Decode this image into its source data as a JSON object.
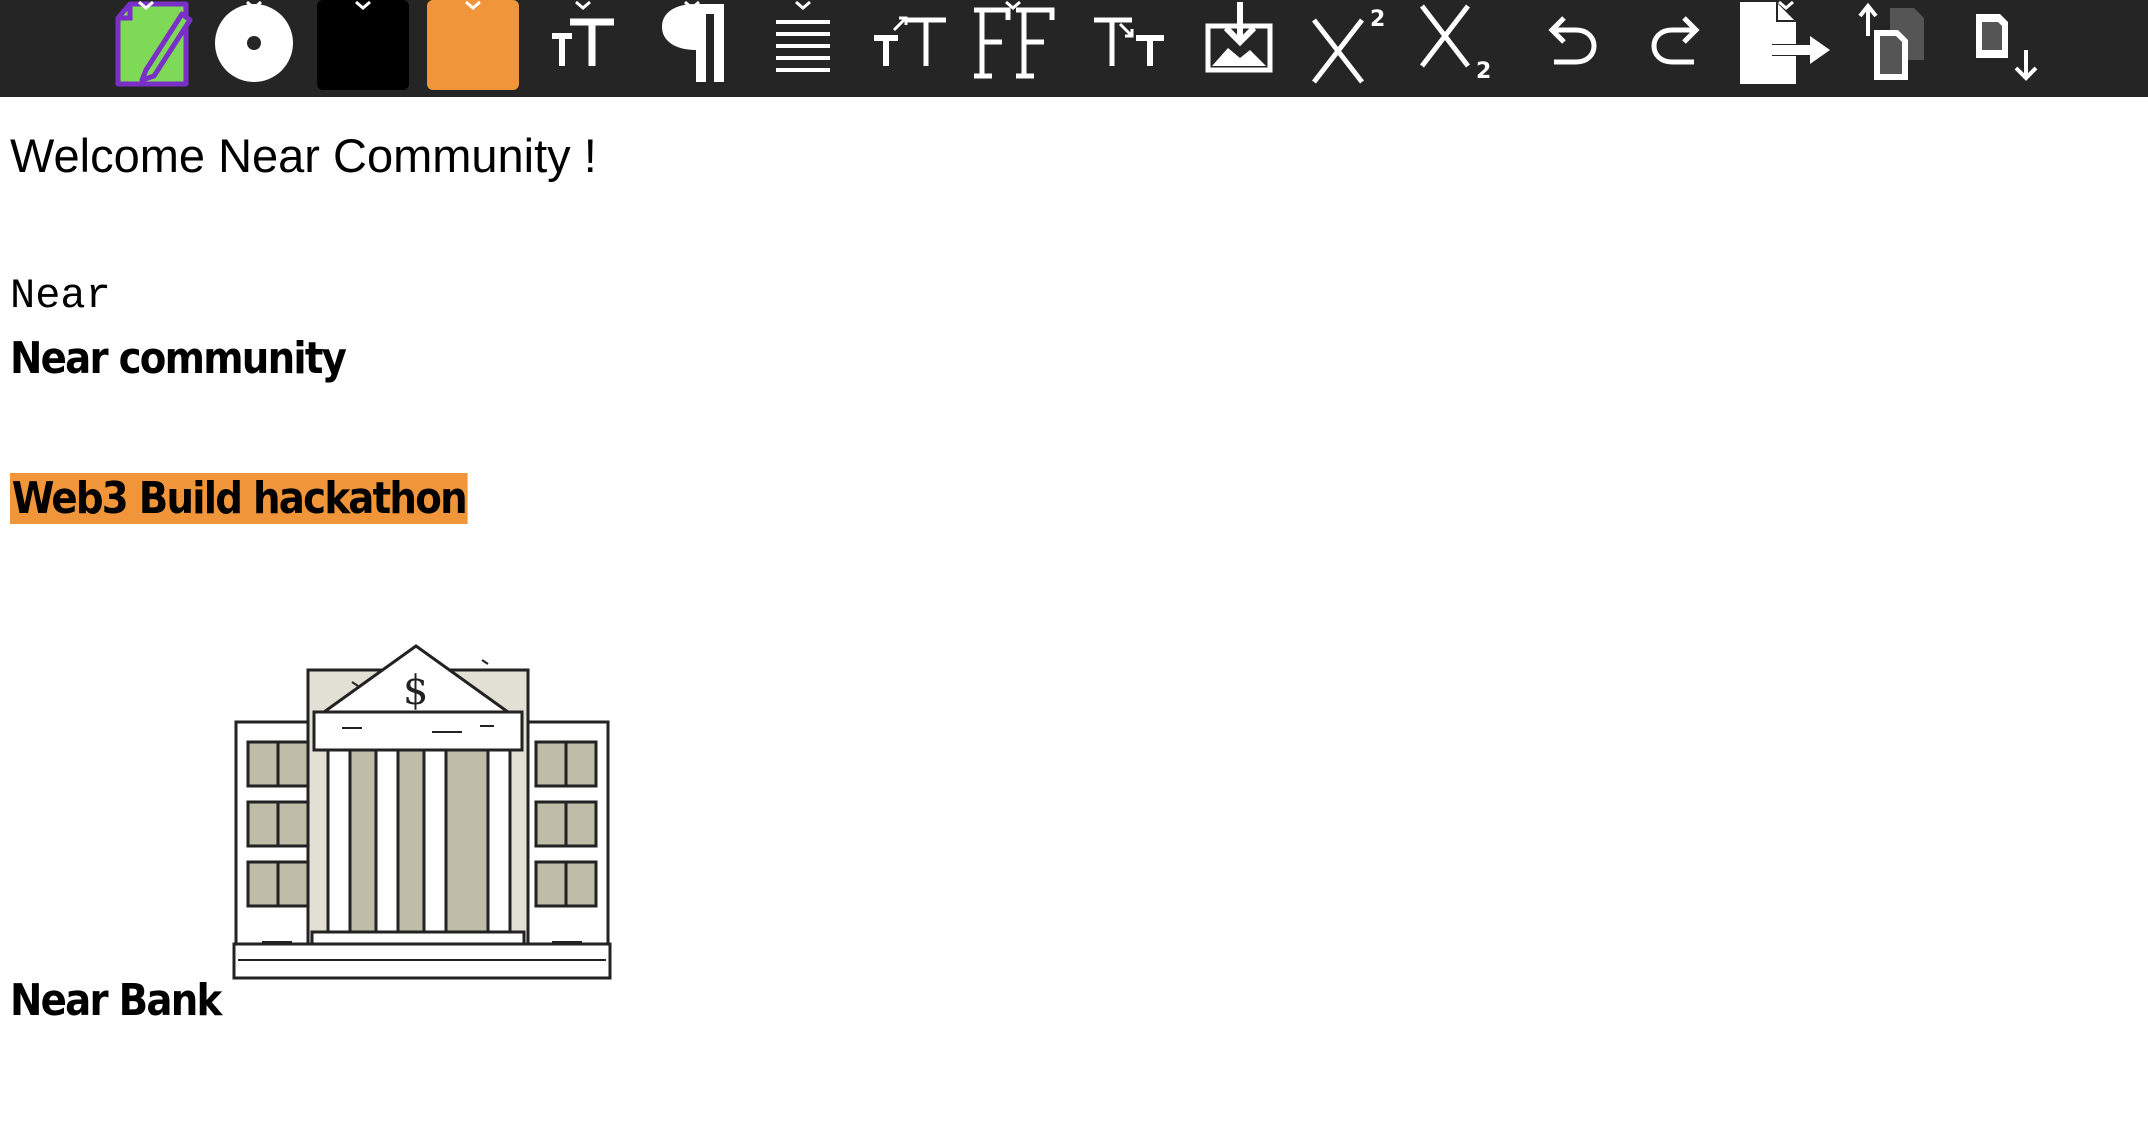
{
  "toolbar": {
    "buttons": [
      {
        "name": "edit-document-icon"
      },
      {
        "name": "disc-icon"
      },
      {
        "name": "text-color-swatch",
        "color": "#000000"
      },
      {
        "name": "highlight-color-swatch",
        "color": "#f0953a"
      },
      {
        "name": "text-size-icon"
      },
      {
        "name": "paragraph-icon"
      },
      {
        "name": "align-icon"
      },
      {
        "name": "increase-font-icon"
      },
      {
        "name": "font-family-icon"
      },
      {
        "name": "decrease-font-icon"
      },
      {
        "name": "insert-image-icon"
      },
      {
        "name": "superscript-icon"
      },
      {
        "name": "subscript-icon"
      },
      {
        "name": "undo-icon"
      },
      {
        "name": "redo-icon"
      },
      {
        "name": "export-icon"
      },
      {
        "name": "copy-upload-icon"
      },
      {
        "name": "download-icon"
      }
    ],
    "colors": {
      "background": "#252525",
      "icon": "#ffffff",
      "accent_green": "#7ed957",
      "accent_purple": "#7b2fc9"
    }
  },
  "document": {
    "welcome": "Welcome Near Community !",
    "mono_line": "Near",
    "bold_line": "Near community",
    "highlight_line": "Web3 Build hackathon",
    "highlight_color": "#f0953a",
    "image_caption": "Near Bank",
    "image_icon": "bank-building-illustration"
  }
}
